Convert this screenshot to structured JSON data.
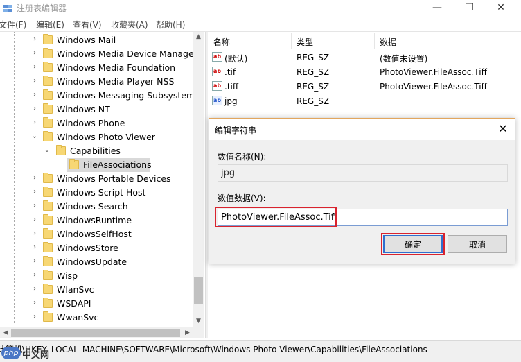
{
  "window": {
    "title": "注册表编辑器",
    "controls": {
      "minimize": "—",
      "maximize": "☐",
      "close": "✕"
    }
  },
  "menu": [
    "文件(F)",
    "编辑(E)",
    "查看(V)",
    "收藏夹(A)",
    "帮助(H)"
  ],
  "tree": {
    "items": [
      {
        "label": "Windows Mail",
        "arrow": "›"
      },
      {
        "label": "Windows Media Device Manager",
        "arrow": "›"
      },
      {
        "label": "Windows Media Foundation",
        "arrow": "›"
      },
      {
        "label": "Windows Media Player NSS",
        "arrow": "›"
      },
      {
        "label": "Windows Messaging Subsystem",
        "arrow": "›"
      },
      {
        "label": "Windows NT",
        "arrow": "›"
      },
      {
        "label": "Windows Phone",
        "arrow": "›"
      },
      {
        "label": "Windows Photo Viewer",
        "arrow": "⌄"
      },
      {
        "label": "Capabilities",
        "arrow": "⌄"
      },
      {
        "label": "FileAssociations",
        "arrow": ""
      },
      {
        "label": "Windows Portable Devices",
        "arrow": "›"
      },
      {
        "label": "Windows Script Host",
        "arrow": "›"
      },
      {
        "label": "Windows Search",
        "arrow": "›"
      },
      {
        "label": "WindowsRuntime",
        "arrow": "›"
      },
      {
        "label": "WindowsSelfHost",
        "arrow": "›"
      },
      {
        "label": "WindowsStore",
        "arrow": "›"
      },
      {
        "label": "WindowsUpdate",
        "arrow": "›"
      },
      {
        "label": "Wisp",
        "arrow": "›"
      },
      {
        "label": "WlanSvc",
        "arrow": "›"
      },
      {
        "label": "WSDAPI",
        "arrow": "›"
      },
      {
        "label": "WwanSvc",
        "arrow": "›"
      }
    ]
  },
  "values": {
    "headers": {
      "name": "名称",
      "type": "类型",
      "data": "数据"
    },
    "rows": [
      {
        "icon": "ab",
        "name": "(默认)",
        "type": "REG_SZ",
        "data": "(数值未设置)"
      },
      {
        "icon": "ab",
        "name": ".tif",
        "type": "REG_SZ",
        "data": "PhotoViewer.FileAssoc.Tiff"
      },
      {
        "icon": "ab",
        "name": ".tiff",
        "type": "REG_SZ",
        "data": "PhotoViewer.FileAssoc.Tiff"
      },
      {
        "icon": "ab",
        "name": "jpg",
        "type": "REG_SZ",
        "data": ""
      }
    ]
  },
  "dialog": {
    "title": "编辑字符串",
    "close": "✕",
    "name_label": "数值名称(N):",
    "name_value": "jpg",
    "data_label": "数值数据(V):",
    "data_value": "PhotoViewer.FileAssoc.Tiff",
    "ok": "确定",
    "cancel": "取消"
  },
  "status": {
    "path": "计算机\\HKEY_LOCAL_MACHINE\\SOFTWARE\\Microsoft\\Windows Photo Viewer\\Capabilities\\FileAssociations"
  },
  "watermark": {
    "badge": "php",
    "text": "中文网"
  }
}
